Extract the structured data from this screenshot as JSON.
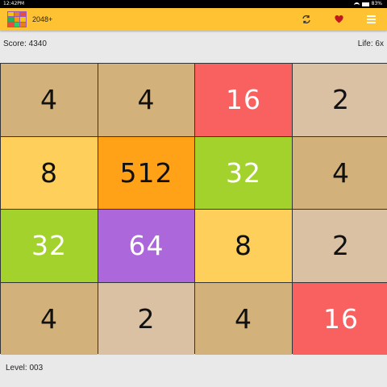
{
  "status": {
    "time": "12:42PM",
    "battery": "83%"
  },
  "app": {
    "title": "2048+",
    "accent": "#ffc233",
    "icons": {
      "logo": "grid-logo-icon",
      "refresh": "refresh-icon",
      "heart": "heart-icon",
      "menu": "menu-icon"
    }
  },
  "info": {
    "score": "Score: 4340",
    "life": "Life: 6x"
  },
  "board": {
    "rows": [
      [
        {
          "value": "4",
          "bg": "#d3b17b",
          "color": "#111"
        },
        {
          "value": "4",
          "bg": "#d3b17b",
          "color": "#111"
        },
        {
          "value": "16",
          "bg": "#f8615f",
          "color": "#ffffff"
        },
        {
          "value": "2",
          "bg": "#dbc1a4",
          "color": "#111"
        }
      ],
      [
        {
          "value": "8",
          "bg": "#ffcf5c",
          "color": "#111"
        },
        {
          "value": "512",
          "bg": "#ffa218",
          "color": "#111"
        },
        {
          "value": "32",
          "bg": "#a3d22c",
          "color": "#ffffff"
        },
        {
          "value": "4",
          "bg": "#d3b17b",
          "color": "#111"
        }
      ],
      [
        {
          "value": "32",
          "bg": "#a3d22c",
          "color": "#ffffff"
        },
        {
          "value": "64",
          "bg": "#ac67db",
          "color": "#ffffff"
        },
        {
          "value": "8",
          "bg": "#ffcf5c",
          "color": "#111"
        },
        {
          "value": "2",
          "bg": "#dbc1a4",
          "color": "#111"
        }
      ],
      [
        {
          "value": "4",
          "bg": "#d3b17b",
          "color": "#111"
        },
        {
          "value": "2",
          "bg": "#dbc1a4",
          "color": "#111"
        },
        {
          "value": "4",
          "bg": "#d3b17b",
          "color": "#111"
        },
        {
          "value": "16",
          "bg": "#f8615f",
          "color": "#ffffff"
        }
      ]
    ]
  },
  "footer": {
    "level": "Level: 003"
  }
}
